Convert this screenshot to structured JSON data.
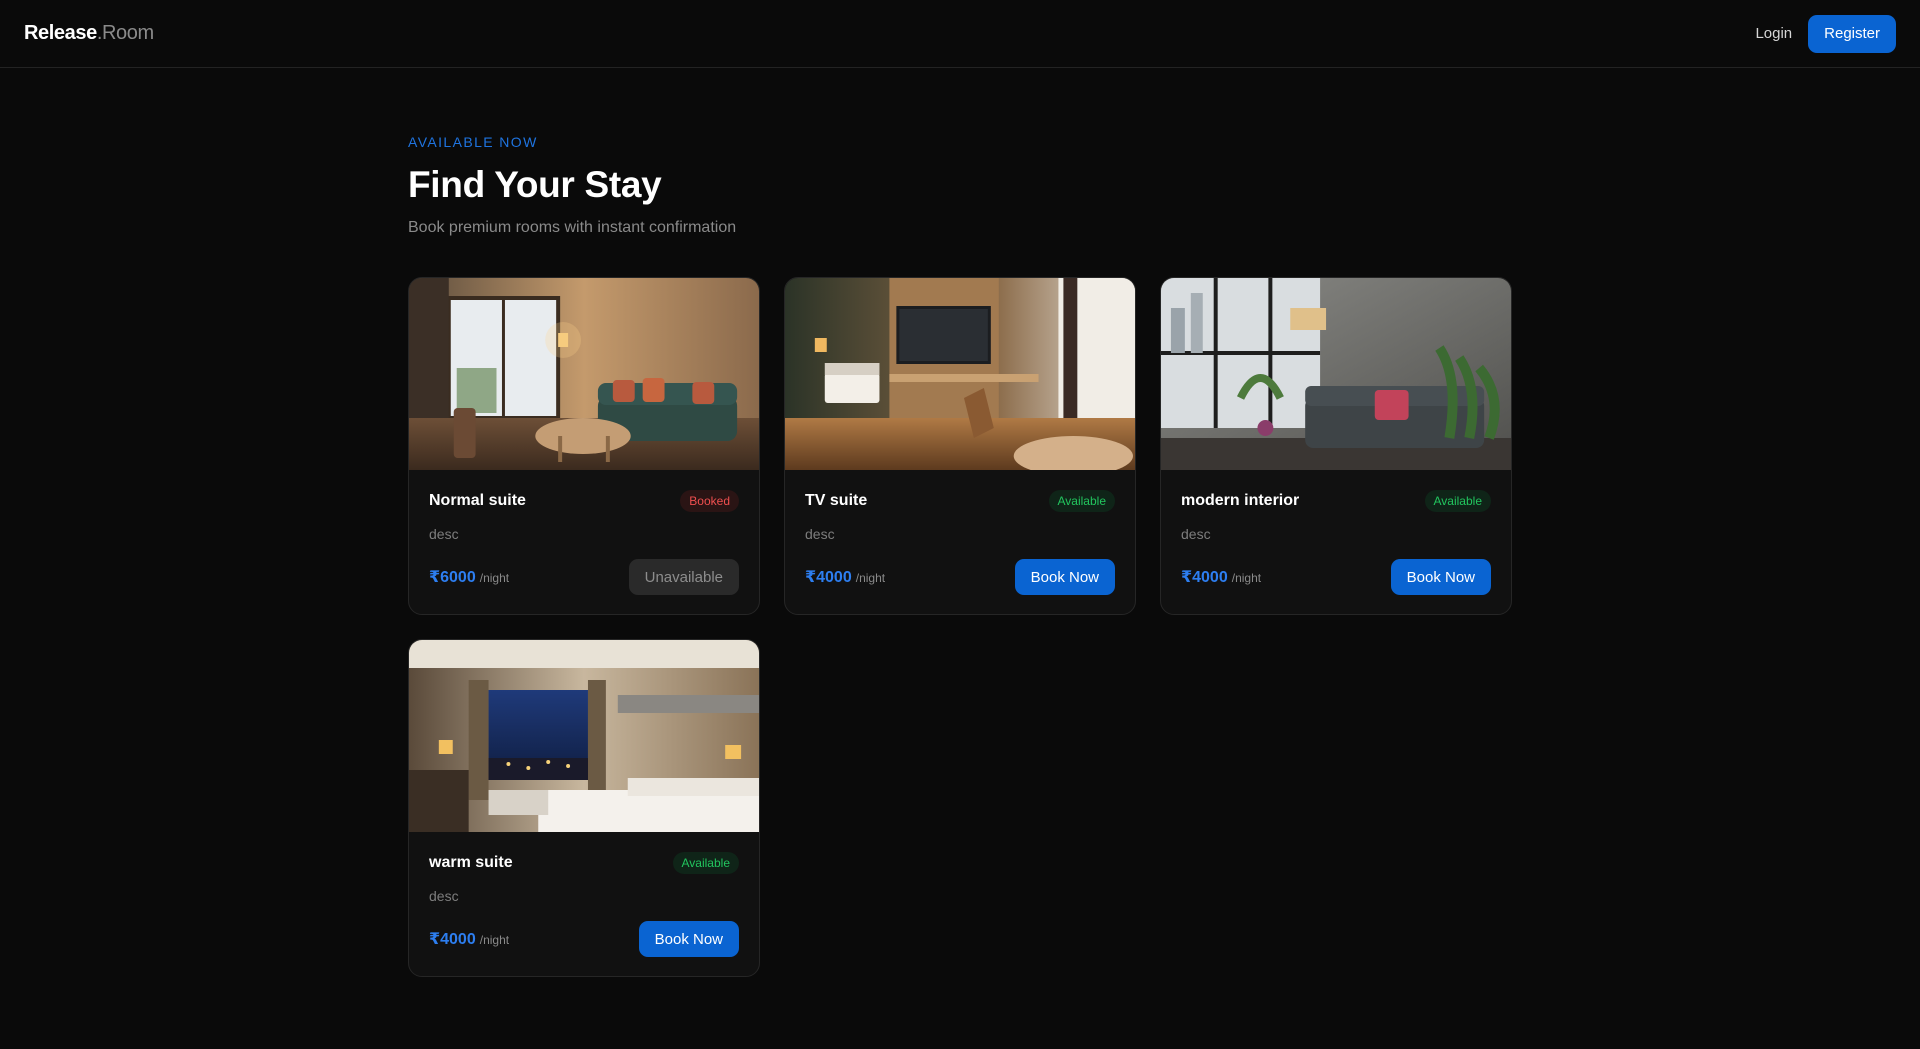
{
  "nav": {
    "brand_main": "Release",
    "brand_suffix": ".Room",
    "login_label": "Login",
    "register_label": "Register"
  },
  "hero": {
    "eyebrow": "AVAILABLE NOW",
    "title": "Find Your Stay",
    "subtitle": "Book premium rooms with instant confirmation"
  },
  "rooms": [
    {
      "name": "Normal suite",
      "status": "Booked",
      "desc": "desc",
      "price": "₹6000",
      "per": "/night",
      "action": "Unavailable",
      "image": "living-room-photo"
    },
    {
      "name": "TV suite",
      "status": "Available",
      "desc": "desc",
      "price": "₹4000",
      "per": "/night",
      "action": "Book Now",
      "image": "hotel-room-tv-photo"
    },
    {
      "name": "modern interior",
      "status": "Available",
      "desc": "desc",
      "price": "₹4000",
      "per": "/night",
      "action": "Book Now",
      "image": "modern-living-room-photo"
    },
    {
      "name": "warm suite",
      "status": "Available",
      "desc": "desc",
      "price": "₹4000",
      "per": "/night",
      "action": "Book Now",
      "image": "hotel-bedroom-city-view-photo"
    }
  ],
  "colors": {
    "accent": "#0a64d2",
    "price": "#2d7ef0",
    "booked": "#ef4f4f",
    "available": "#22c55e",
    "background": "#0a0a0a",
    "card": "#111111"
  }
}
